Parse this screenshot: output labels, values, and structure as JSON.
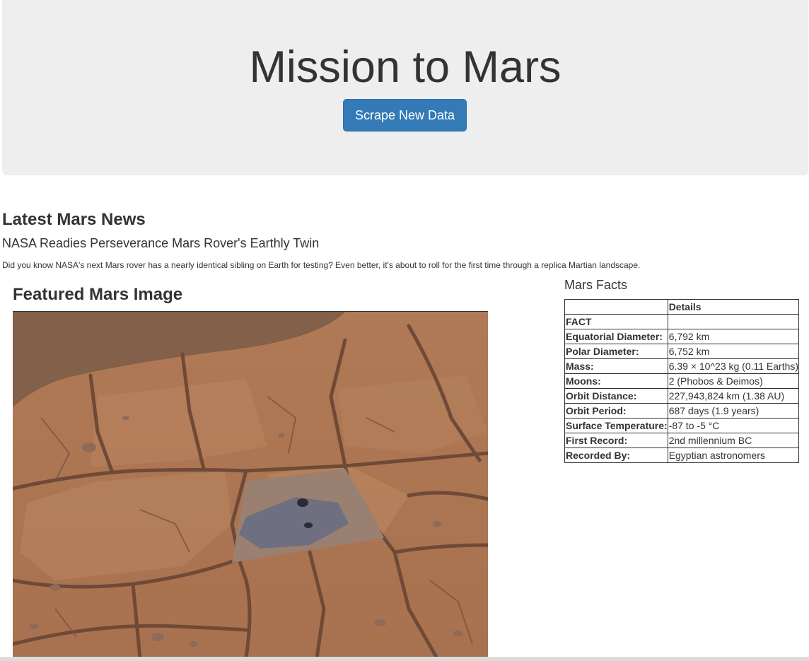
{
  "header": {
    "title": "Mission to Mars",
    "scrape_button_label": "Scrape New Data"
  },
  "news": {
    "heading": "Latest Mars News",
    "title": "NASA Readies Perseverance Mars Rover's Earthly Twin",
    "paragraph": "Did you know NASA's next Mars rover has a nearly identical sibling on Earth for testing? Even better, it's about to roll for the first time through a replica Martian landscape."
  },
  "featured": {
    "heading": "Featured Mars Image"
  },
  "facts": {
    "heading": "Mars Facts",
    "columns": [
      "",
      "Details"
    ],
    "header_row": [
      "FACT",
      ""
    ],
    "rows": [
      {
        "label": "Equatorial Diameter:",
        "value": "6,792 km"
      },
      {
        "label": "Polar Diameter:",
        "value": "6,752 km"
      },
      {
        "label": "Mass:",
        "value": "6.39 × 10^23 kg (0.11 Earths)"
      },
      {
        "label": "Moons:",
        "value": "2 (Phobos & Deimos)"
      },
      {
        "label": "Orbit Distance:",
        "value": "227,943,824 km (1.38 AU)"
      },
      {
        "label": "Orbit Period:",
        "value": "687 days (1.9 years)"
      },
      {
        "label": "Surface Temperature:",
        "value": "-87 to -5 °C"
      },
      {
        "label": "First Record:",
        "value": "2nd millennium BC"
      },
      {
        "label": "Recorded By:",
        "value": "Egyptian astronomers"
      }
    ]
  },
  "colors": {
    "jumbotron_bg": "#eeeeee",
    "button_bg": "#337ab7",
    "text": "#333333"
  }
}
